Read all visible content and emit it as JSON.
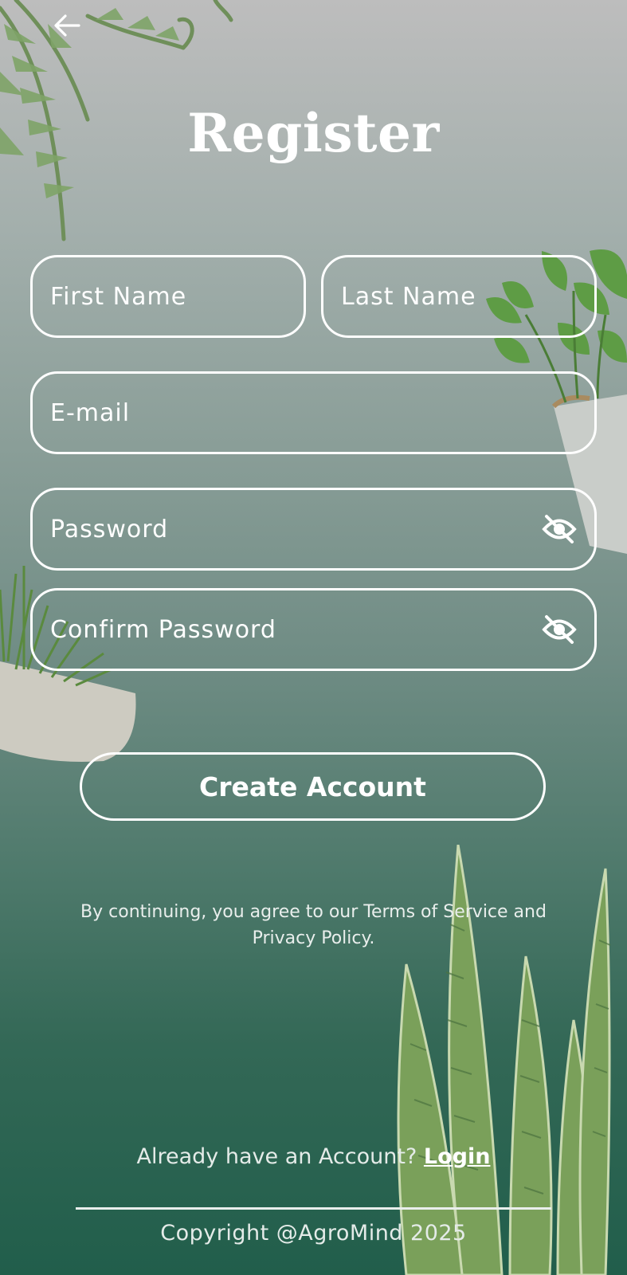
{
  "header": {
    "back_icon": "arrow-left-icon",
    "title": "Register"
  },
  "form": {
    "first_name": {
      "placeholder": "First Name"
    },
    "last_name": {
      "placeholder": "Last Name"
    },
    "email": {
      "placeholder": "E-mail"
    },
    "password": {
      "placeholder": "Password",
      "toggle_icon": "eye-off-icon"
    },
    "confirm_password": {
      "placeholder": "Confirm Password",
      "toggle_icon": "eye-off-icon"
    },
    "submit_label": "Create Account"
  },
  "terms_text": "By continuing, you agree to our Terms of Service and Privacy Policy.",
  "footer": {
    "prompt": "Already have an Account?",
    "login_label": "Login",
    "copyright": "Copyright @AgroMind 2025"
  },
  "colors": {
    "accent": "#ffffff",
    "bg_top": "#bdbdbd",
    "bg_bottom": "#215e4b"
  }
}
